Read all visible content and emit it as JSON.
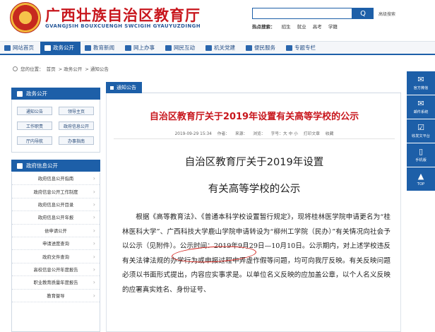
{
  "header": {
    "title": "广西壮族自治区教育厅",
    "subtitle": "GVANGJSIH BOUXCUENGH SWCIGIH GYAUYUZDINGH",
    "search_button": "Q",
    "advanced_search": "高级搜索",
    "hot_label": "热点搜索：",
    "hot_words": [
      "招生",
      "就业",
      "高考",
      "学籍"
    ]
  },
  "nav": {
    "items": [
      {
        "label": "网站首页",
        "active": false
      },
      {
        "label": "政务公开",
        "active": true
      },
      {
        "label": "教育新闻",
        "active": false
      },
      {
        "label": "网上办事",
        "active": false
      },
      {
        "label": "网民互动",
        "active": false
      },
      {
        "label": "机关党建",
        "active": false
      },
      {
        "label": "便民服务",
        "active": false
      },
      {
        "label": "专题专栏",
        "active": false
      }
    ]
  },
  "breadcrumb": {
    "prefix": "您的位置：",
    "items": [
      "首页",
      "> 政务公开",
      "> 通知公告"
    ]
  },
  "sidebar": {
    "gov_title": "政务公开",
    "gov_buttons": [
      "通知公告",
      "领导主页",
      "工作职责",
      "政府信息公开",
      "厅内导航",
      "办事指南"
    ],
    "info_title": "政府信息公开",
    "info_items": [
      "政府信息公开指南",
      "政府信息公开工作制度",
      "政府信息公开目录",
      "政府信息公开年报",
      "依申请公开",
      "申请进度查询",
      "政府文件查询",
      "高校信息公开年度报告",
      "职业教育质量年度报告",
      "教育督导"
    ]
  },
  "content": {
    "tab": "通知公告",
    "title": "自治区教育厅关于2019年设置有关高等学校的公示",
    "meta": [
      "2019-09-29 15:34",
      "作者：",
      "来源：",
      "浏览：",
      "字号：大 中 小",
      "打印文章",
      "收藏"
    ],
    "doc_title_line1": "自治区教育厅关于2019年设置",
    "doc_title_line2": "有关高等学校的公示",
    "body": "根据《高等教育法》、《普通本科学校设置暂行规定》，现将桂林医学院申请更名为“桂林医科大学”、广西科技大学鹿山学院申请转设为“柳州工学院（民办）”有关情况向社会予以公示（见附件）。公示时间：2019年9月29日—10月10日。公示期内，对上述学校违反有关法律法规的办学行为或申报过程中弄虚作假等问题，均可向我厅反映。有关反映问题必须以书面形式提出，内容应实事求是。以单位名义反映的应加盖公章，以个人名义反映的应署真实姓名、身份证号、"
  },
  "float_bar": [
    {
      "icon": "wechat-icon",
      "glyph": "✉",
      "label": "官方微信"
    },
    {
      "icon": "mail-icon",
      "glyph": "✉",
      "label": "邮件系统"
    },
    {
      "icon": "document-icon",
      "glyph": "☑",
      "label": "收发文平台"
    },
    {
      "icon": "phone-icon",
      "glyph": "▯",
      "label": "手机版"
    },
    {
      "icon": "top-icon",
      "glyph": "▲",
      "label": "TOP"
    }
  ],
  "colors": {
    "brand_blue": "#1d5fa8",
    "title_red": "#c8161d"
  }
}
